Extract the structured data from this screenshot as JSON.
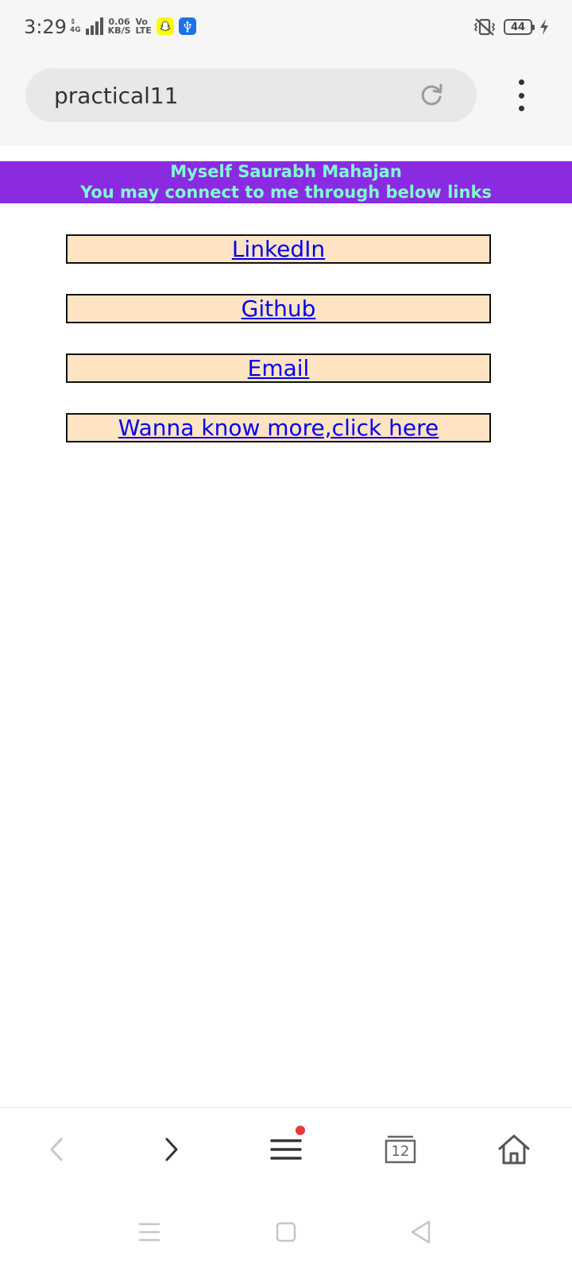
{
  "status_bar": {
    "time": "3:29",
    "network_type": "4G",
    "speed_value": "0.06",
    "speed_unit": "KB/S",
    "volte_top": "Vo",
    "volte_bottom": "LTE",
    "battery_level": "44",
    "icons": [
      "signal-icon",
      "snapchat-icon",
      "usb-icon",
      "vibrate-icon",
      "battery-icon",
      "charging-icon"
    ]
  },
  "browser": {
    "url_text": "practical11",
    "icons": [
      "reload-icon",
      "more-menu-icon"
    ]
  },
  "page": {
    "header_line1": "Myself Saurabh Mahajan",
    "header_line2": "You may connect to me through below links",
    "links": [
      {
        "label": "LinkedIn"
      },
      {
        "label": "Github"
      },
      {
        "label": "Email"
      },
      {
        "label": "Wanna know more,click here"
      }
    ],
    "colors": {
      "header_bg": "#8a2be2",
      "header_text": "#7fffd4",
      "link_box_bg": "#ffe4c4",
      "link_text": "#0000ee"
    }
  },
  "bottom_nav": {
    "tabs_count": "12",
    "items": [
      "back-icon",
      "forward-icon",
      "menu-icon",
      "tabs-icon",
      "home-icon"
    ],
    "menu_has_notification": true
  },
  "system_nav": {
    "items": [
      "recent-apps-icon",
      "home-button-icon",
      "back-button-icon"
    ]
  }
}
